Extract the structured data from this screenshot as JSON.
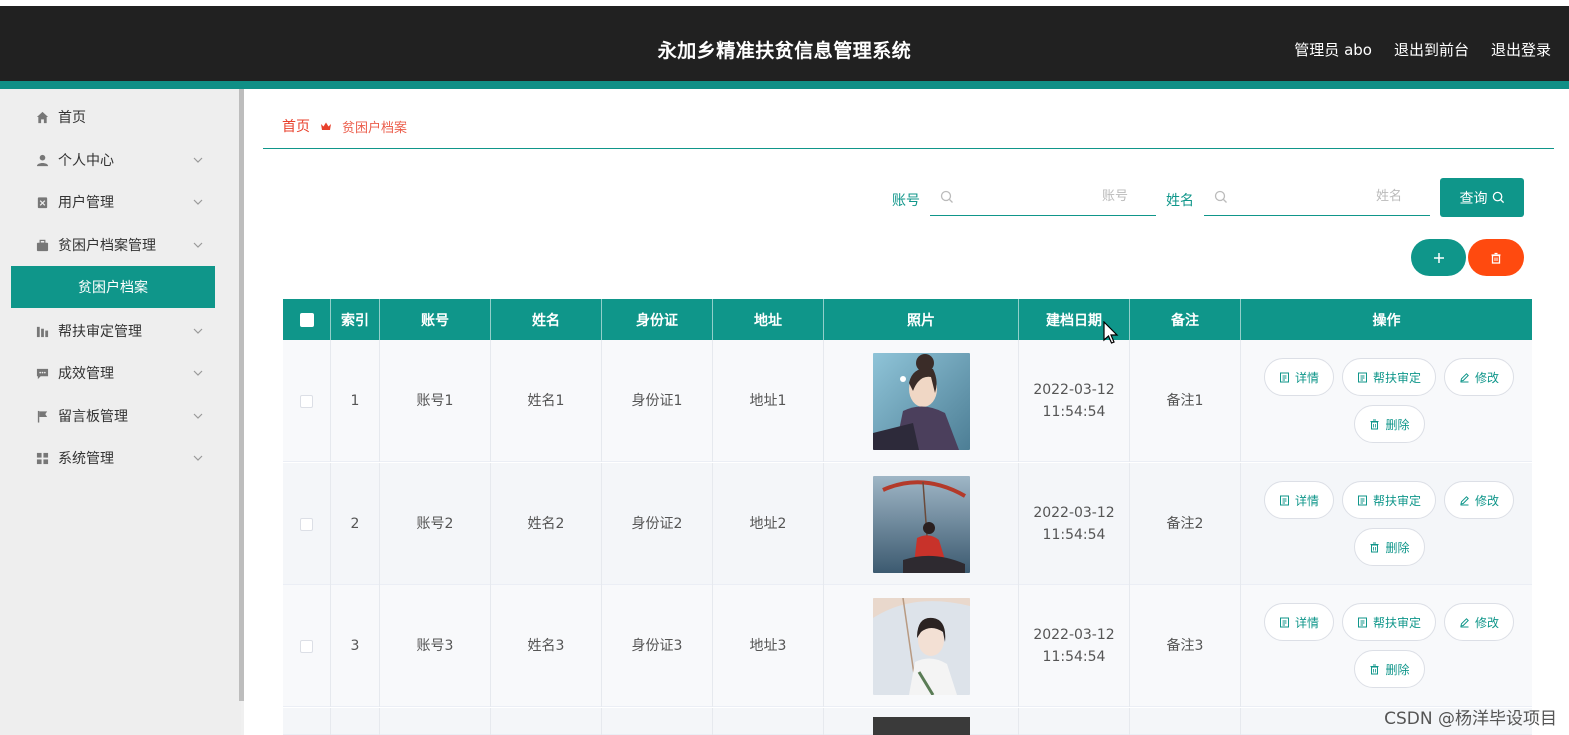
{
  "header": {
    "title": "永加乡精准扶贫信息管理系统",
    "links": [
      "管理员 abo",
      "退出到前台",
      "退出登录"
    ]
  },
  "sidebar": {
    "items": [
      {
        "label": "首页",
        "icon": "home-icon"
      },
      {
        "label": "个人中心",
        "icon": "user-icon"
      },
      {
        "label": "用户管理",
        "icon": "clipboard-icon"
      },
      {
        "label": "贫困户档案管理",
        "icon": "briefcase-icon"
      },
      {
        "label": "帮扶审定管理",
        "icon": "chart-icon"
      },
      {
        "label": "成效管理",
        "icon": "message-icon"
      },
      {
        "label": "留言板管理",
        "icon": "flag-icon"
      },
      {
        "label": "系统管理",
        "icon": "grid-icon"
      }
    ],
    "active_submenu": "贫困户档案"
  },
  "breadcrumb": {
    "home": "首页",
    "current": "贫困户档案"
  },
  "search": {
    "account_label": "账号",
    "account_placeholder": "账号",
    "name_label": "姓名",
    "name_placeholder": "姓名",
    "query_button": "查询"
  },
  "table": {
    "columns": [
      "索引",
      "账号",
      "姓名",
      "身份证",
      "地址",
      "照片",
      "建档日期",
      "备注",
      "操作"
    ],
    "rows": [
      {
        "index": "1",
        "account": "账号1",
        "name": "姓名1",
        "id_card": "身份证1",
        "address": "地址1",
        "date": "2022-03-12 11:54:54",
        "note": "备注1"
      },
      {
        "index": "2",
        "account": "账号2",
        "name": "姓名2",
        "id_card": "身份证2",
        "address": "地址2",
        "date": "2022-03-12 11:54:54",
        "note": "备注2"
      },
      {
        "index": "3",
        "account": "账号3",
        "name": "姓名3",
        "id_card": "身份证3",
        "address": "地址3",
        "date": "2022-03-12 11:54:54",
        "note": "备注3"
      }
    ],
    "actions": {
      "detail": "详情",
      "review": "帮扶审定",
      "edit": "修改",
      "delete": "删除"
    }
  },
  "watermark": "CSDN @杨洋毕设项目",
  "colors": {
    "accent": "#0f968a",
    "danger": "#ff4a0f",
    "header": "#212121",
    "breadcrumb": "#e8412c"
  }
}
